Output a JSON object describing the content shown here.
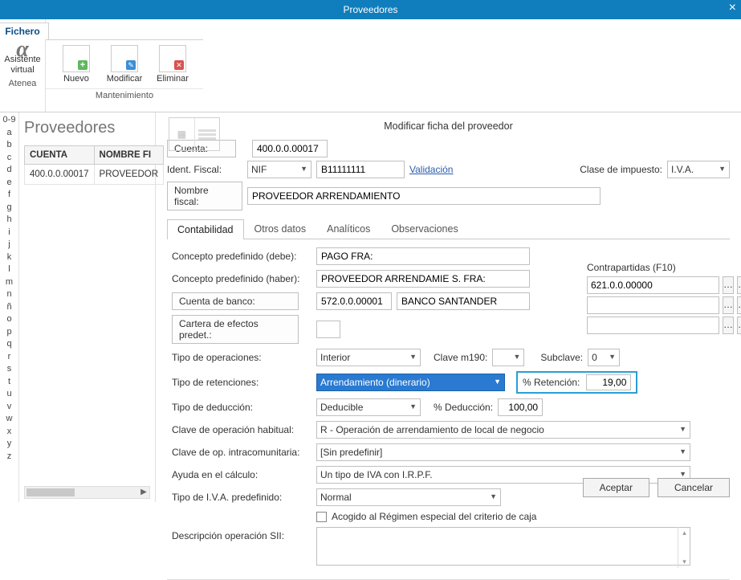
{
  "window": {
    "title": "Proveedores"
  },
  "ribbon": {
    "fichero": "Fichero",
    "asistente": "Asistente virtual",
    "atenea": "Atenea",
    "nuevo": "Nuevo",
    "modificar": "Modificar",
    "eliminar": "Eliminar",
    "mantenimiento": "Mantenimiento"
  },
  "az": [
    "0-9",
    "a",
    "b",
    "c",
    "d",
    "e",
    "f",
    "g",
    "h",
    "i",
    "j",
    "k",
    "l",
    "m",
    "n",
    "ñ",
    "o",
    "p",
    "q",
    "r",
    "s",
    "t",
    "u",
    "v",
    "w",
    "x",
    "y",
    "z"
  ],
  "list": {
    "heading": "Proveedores",
    "col_cuenta": "CUENTA",
    "col_nombre": "NOMBRE FI",
    "row_cuenta": "400.0.0.00017",
    "row_nombre": "PROVEEDOR"
  },
  "dialog": {
    "title": "Modificar ficha del proveedor",
    "cuenta_lbl": "Cuenta:",
    "cuenta_val": "400.0.0.00017",
    "ident_lbl": "Ident. Fiscal:",
    "ident_tipo": "NIF",
    "ident_val": "B11111111",
    "validacion": "Validación",
    "clase_imp_lbl": "Clase de impuesto:",
    "clase_imp_val": "I.V.A.",
    "nombre_btn": "Nombre fiscal:",
    "nombre_val": "PROVEEDOR ARRENDAMIENTO",
    "tabs": {
      "t1": "Contabilidad",
      "t2": "Otros datos",
      "t3": "Analíticos",
      "t4": "Observaciones"
    },
    "concepto_debe_lbl": "Concepto predefinido (debe):",
    "concepto_debe_val": "PAGO FRA:",
    "concepto_haber_lbl": "Concepto predefinido (haber):",
    "concepto_haber_val": "PROVEEDOR ARRENDAMIE S. FRA:",
    "cuenta_banco_btn": "Cuenta de banco:",
    "cuenta_banco_num": "572.0.0.00001",
    "cuenta_banco_nom": "BANCO SANTANDER",
    "cartera_btn": "Cartera de efectos predet.:",
    "contrapartidas": "Contrapartidas (F10)",
    "contra1": "621.0.0.00000",
    "tipo_op_lbl": "Tipo de operaciones:",
    "tipo_op_val": "Interior",
    "clave_m190_lbl": "Clave m190:",
    "subclave_lbl": "Subclave:",
    "subclave_val": "0",
    "tipo_ret_lbl": "Tipo de retenciones:",
    "tipo_ret_val": "Arrendamiento (dinerario)",
    "pct_ret_lbl": "% Retención:",
    "pct_ret_val": "19,00",
    "tipo_ded_lbl": "Tipo de deducción:",
    "tipo_ded_val": "Deducible",
    "pct_ded_lbl": "% Deducción:",
    "pct_ded_val": "100,00",
    "clave_hab_lbl": "Clave de operación habitual:",
    "clave_hab_val": "R - Operación de arrendamiento de local de negocio",
    "clave_intra_lbl": "Clave de op. intracomunitaria:",
    "clave_intra_val": "[Sin predefinir]",
    "ayuda_lbl": "Ayuda en el cálculo:",
    "ayuda_val": "Un tipo de IVA con I.R.P.F.",
    "iva_pred_lbl": "Tipo de I.V.A. predefinido:",
    "iva_pred_val": "Normal",
    "acogido": "Acogido al Régimen especial del criterio de caja",
    "sii_lbl": "Descripción operación SII:",
    "aceptar": "Aceptar",
    "cancelar": "Cancelar"
  }
}
